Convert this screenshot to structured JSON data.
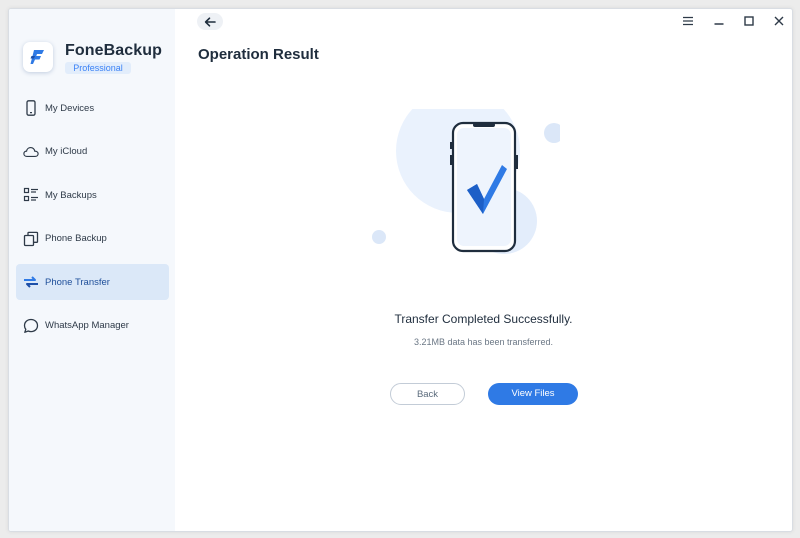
{
  "app": {
    "name": "FoneBackup",
    "edition": "Professional"
  },
  "sidebar": {
    "items": [
      {
        "label": "My Devices",
        "icon": "phone-outline-icon",
        "active": false
      },
      {
        "label": "My iCloud",
        "icon": "cloud-icon",
        "active": false
      },
      {
        "label": "My Backups",
        "icon": "backups-list-icon",
        "active": false
      },
      {
        "label": "Phone Backup",
        "icon": "copy-icon",
        "active": false
      },
      {
        "label": "Phone Transfer",
        "icon": "transfer-arrows-icon",
        "active": true
      },
      {
        "label": "WhatsApp Manager",
        "icon": "chat-bubble-icon",
        "active": false
      }
    ]
  },
  "header": {
    "title": "Operation Result"
  },
  "result": {
    "title": "Transfer Completed Successfully.",
    "subtitle": "3.21MB data has been transferred."
  },
  "buttons": {
    "back": "Back",
    "view_files": "View Files"
  },
  "colors": {
    "accent": "#2f7ae5",
    "sidebar_bg": "#f5f8fc",
    "active_item_bg": "#dbe8f8",
    "title_text": "#1f2d3d"
  }
}
